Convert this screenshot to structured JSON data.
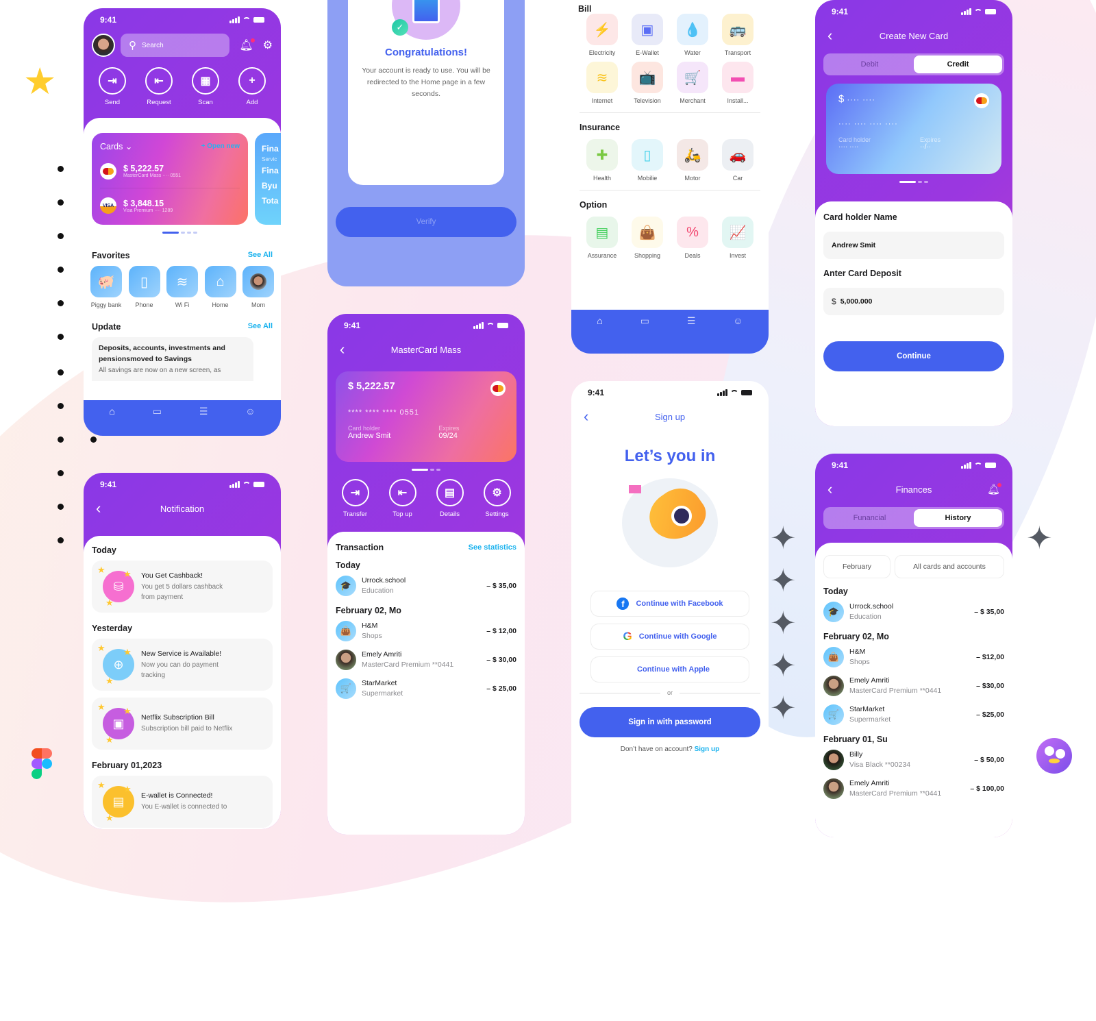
{
  "status_time": "9:41",
  "home": {
    "search_placeholder": "Search",
    "actions": [
      {
        "label": "Send",
        "icon": "send-icon",
        "glyph": "⇥"
      },
      {
        "label": "Request",
        "icon": "request-icon",
        "glyph": "⇤"
      },
      {
        "label": "Scan",
        "icon": "qr-scan-icon",
        "glyph": "▦"
      },
      {
        "label": "Add",
        "icon": "plus-icon",
        "glyph": "+"
      }
    ],
    "cards_title": "Cards",
    "open_new": "+ Open new",
    "cards": [
      {
        "amount": "$ 5,222.57",
        "sub": "MasterCard Mass ···· 0551",
        "brand": "mastercard"
      },
      {
        "amount": "$ 3,848.15",
        "sub": "Visa Premium ···· 1289",
        "brand": "VISA"
      }
    ],
    "side_card": {
      "title": "Fina",
      "sub": "Servic",
      "lines": [
        "Fina",
        "Byu",
        "Tota"
      ]
    },
    "favorites_title": "Favorites",
    "see_all": "See All",
    "favorites": [
      {
        "label": "Piggy bank",
        "icon": "piggy-bank-icon",
        "glyph": "🐖"
      },
      {
        "label": "Phone",
        "icon": "phone-icon",
        "glyph": "▯"
      },
      {
        "label": "Wi Fi",
        "icon": "wifi-icon",
        "glyph": "≋"
      },
      {
        "label": "Home",
        "icon": "home-icon",
        "glyph": "⌂"
      },
      {
        "label": "Mom",
        "icon": "avatar",
        "glyph": ""
      }
    ],
    "update_title": "Update",
    "update_card": {
      "title": "Deposits, accounts, investments and pensionsmoved to Savings",
      "body": "All savings are now on a new screen, as"
    }
  },
  "tabbar": [
    {
      "name": "home-tab",
      "glyph": "⌂"
    },
    {
      "name": "cards-tab",
      "glyph": "▭"
    },
    {
      "name": "reports-tab",
      "glyph": "☰"
    },
    {
      "name": "support-tab",
      "glyph": "☺"
    }
  ],
  "notification": {
    "title": "Notification",
    "groups": [
      {
        "label": "Today",
        "items": [
          {
            "title": "You Get Cashback!",
            "body": "You get 5 dollars cashback from payment",
            "color": "#f66fd0",
            "glyph": "⛁"
          }
        ]
      },
      {
        "label": "Yesterday",
        "items": [
          {
            "title": "New Service is Available!",
            "body": "Now you can do payment tracking",
            "color": "#7ccdf9",
            "glyph": "⊕"
          },
          {
            "title": "Netflix Subscription Bill",
            "body": "Subscription bill paid to Netflix",
            "color": "#c65de0",
            "glyph": "▣"
          }
        ]
      },
      {
        "label": "February 01,2023",
        "items": [
          {
            "title": "E-wallet is Connected!",
            "body": "You E-wallet is connected to",
            "color": "#fbc02d",
            "glyph": "▤"
          }
        ]
      }
    ]
  },
  "congrats": {
    "title": "Congratulations!",
    "body": "Your account is ready to use. You will be redirected to the Home page in a few seconds.",
    "verify": "Verify"
  },
  "mastercard": {
    "title": "MasterCard Mass",
    "balance": "$ 5,222.57",
    "number": "****  ****  ****  0551",
    "holder_label": "Card holder",
    "holder": "Andrew Smit",
    "expires_label": "Expires",
    "expires": "09/24",
    "actions": [
      {
        "label": "Transfer",
        "icon": "transfer-icon",
        "glyph": "⇥"
      },
      {
        "label": "Top up",
        "icon": "top-up-icon",
        "glyph": "⇤"
      },
      {
        "label": "Details",
        "icon": "details-icon",
        "glyph": "▤"
      },
      {
        "label": "Settings",
        "icon": "gear-icon",
        "glyph": "⚙"
      }
    ],
    "transaction_title": "Transaction",
    "see_statistics": "See statistics",
    "groups": [
      {
        "label": "Today",
        "items": [
          {
            "name": "Urrock.school",
            "sub": "Education",
            "amount": "– $ 35,00",
            "glyph": "🎓",
            "av": ""
          }
        ]
      },
      {
        "label": "February 02, Mo",
        "items": [
          {
            "name": "H&M",
            "sub": "Shops",
            "amount": "– $ 12,00",
            "glyph": "👜",
            "av": ""
          },
          {
            "name": "Emely Amriti",
            "sub": "MasterCard Premium **0441",
            "amount": "– $ 30,00",
            "glyph": "",
            "av": "photo"
          },
          {
            "name": "StarMarket",
            "sub": "Supermarket",
            "amount": "– $ 25,00",
            "glyph": "🛒",
            "av": ""
          }
        ]
      }
    ]
  },
  "payments": {
    "sections": [
      {
        "title": "Bill",
        "items": [
          {
            "label": "Electricity",
            "icon": "electricity-icon",
            "glyph": "⚡",
            "bg": "#fde7e7",
            "fg": "#f4574e"
          },
          {
            "label": "E-Wallet",
            "icon": "wallet-icon",
            "glyph": "▣",
            "bg": "#e8eaf8",
            "fg": "#5b6ef5"
          },
          {
            "label": "Water",
            "icon": "water-drop-icon",
            "glyph": "💧",
            "bg": "#e3f1fd",
            "fg": "#42a5f5"
          },
          {
            "label": "Transport",
            "icon": "bus-icon",
            "glyph": "🚌",
            "bg": "#fdf1cf",
            "fg": "#f9c846"
          },
          {
            "label": "Internet",
            "icon": "wifi-icon",
            "glyph": "≋",
            "bg": "#fdf6d8",
            "fg": "#f9c31e"
          },
          {
            "label": "Television",
            "icon": "tv-icon",
            "glyph": "📺",
            "bg": "#fde6e0",
            "fg": "#f45d3a"
          },
          {
            "label": "Merchant",
            "icon": "cart-icon",
            "glyph": "🛒",
            "bg": "#f5e6fa",
            "fg": "#d742e7"
          },
          {
            "label": "Install...",
            "icon": "credit-card-icon",
            "glyph": "▬",
            "bg": "#fde6ee",
            "fg": "#f24fb2"
          }
        ]
      },
      {
        "title": "Insurance",
        "items": [
          {
            "label": "Health",
            "icon": "shield-icon",
            "glyph": "✚",
            "bg": "#edf6ea",
            "fg": "#7ac943"
          },
          {
            "label": "Mobilie",
            "icon": "mobile-icon",
            "glyph": "▯",
            "bg": "#e3f6fb",
            "fg": "#3fd0ea"
          },
          {
            "label": "Motor",
            "icon": "scooter-icon",
            "glyph": "🛵",
            "bg": "#f4e8e6",
            "fg": "#d67b6a"
          },
          {
            "label": "Car",
            "icon": "car-icon",
            "glyph": "🚗",
            "bg": "#eceff3",
            "fg": "#3f8ef0"
          }
        ]
      },
      {
        "title": "Option",
        "items": [
          {
            "label": "Assurance",
            "icon": "assurance-icon",
            "glyph": "▤",
            "bg": "#e8f6ea",
            "fg": "#3ecf58"
          },
          {
            "label": "Shopping",
            "icon": "shopping-bag-icon",
            "glyph": "👜",
            "bg": "#fefaea",
            "fg": "#f5c93d"
          },
          {
            "label": "Deals",
            "icon": "discount-icon",
            "glyph": "%",
            "bg": "#fde7ed",
            "fg": "#f2466e"
          },
          {
            "label": "Invest",
            "icon": "chart-up-icon",
            "glyph": "📈",
            "bg": "#e2f6f3",
            "fg": "#2bd5c4"
          }
        ]
      }
    ]
  },
  "signup": {
    "nav_title": "Sign up",
    "heading": "Let’s you in",
    "facebook": "Continue with Facebook",
    "google": "Continue with Google",
    "apple": "Continue with Apple",
    "or": "or",
    "password": "Sign in with password",
    "no_account": "Don’t have on account?",
    "sign_up_link": "Sign up"
  },
  "create_card": {
    "title": "Create New Card",
    "tabs": [
      "Debit",
      "Credit"
    ],
    "active_tab": "Credit",
    "card_amount_mask": "···· ····",
    "card_number_mask": "···· ···· ···· ····",
    "holder_label": "Card holder",
    "holder_mask": "···· ····",
    "expires_label": "Expires",
    "expires_mask": "··/··",
    "name_label": "Card holder Name",
    "name_value": "Andrew Smit",
    "deposit_label": "Anter Card Deposit",
    "deposit_value": "5,000.000",
    "currency": "$",
    "continue": "Continue"
  },
  "finances": {
    "title": "Finances",
    "tabs": [
      "Funancial",
      "History"
    ],
    "active_tab": "History",
    "filters": [
      "February",
      "All cards and accounts"
    ],
    "groups": [
      {
        "label": "Today",
        "items": [
          {
            "name": "Urrock.school",
            "sub": "Education",
            "amount": "– $ 35,00",
            "glyph": "🎓",
            "av": ""
          }
        ]
      },
      {
        "label": "February 02, Mo",
        "items": [
          {
            "name": "H&M",
            "sub": "Shops",
            "amount": "– $12,00",
            "glyph": "👜",
            "av": ""
          },
          {
            "name": "Emely Amriti",
            "sub": "MasterCard Premium **0441",
            "amount": "– $30,00",
            "glyph": "",
            "av": "photo"
          },
          {
            "name": "StarMarket",
            "sub": "Supermarket",
            "amount": "– $25,00",
            "glyph": "🛒",
            "av": ""
          }
        ]
      },
      {
        "label": "February 01, Su",
        "items": [
          {
            "name": "Billy",
            "sub": "Visa Black **00234",
            "amount": "– $ 50,00",
            "glyph": "",
            "av": "photo2"
          },
          {
            "name": "Emely Amriti",
            "sub": "MasterCard Premium **0441",
            "amount": "– $ 100,00",
            "glyph": "",
            "av": "photo"
          }
        ]
      }
    ]
  }
}
